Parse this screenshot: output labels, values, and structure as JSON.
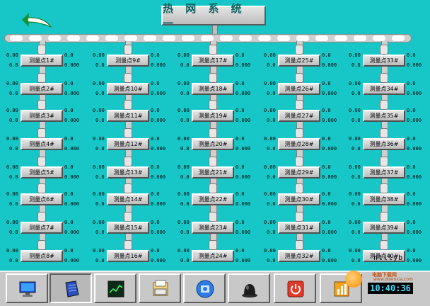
{
  "window": {
    "title": "热 网 系 统 一"
  },
  "colors": {
    "background": "#17c7c7",
    "pipe": "#cfcfcf",
    "clock_text": "#3fe0ff"
  },
  "points": [
    {
      "label": "测量点1#",
      "left": [
        "0.00",
        "0.0"
      ],
      "right": [
        "0.0",
        "0.000"
      ]
    },
    {
      "label": "测量点2#",
      "left": [
        "0.00",
        "0.0"
      ],
      "right": [
        "0.0",
        "0.000"
      ]
    },
    {
      "label": "测量点3#",
      "left": [
        "0.00",
        "0.0"
      ],
      "right": [
        "0.0",
        "0.000"
      ]
    },
    {
      "label": "测量点4#",
      "left": [
        "0.00",
        "0.0"
      ],
      "right": [
        "0.0",
        "0.000"
      ]
    },
    {
      "label": "测量点5#",
      "left": [
        "0.00",
        "0.0"
      ],
      "right": [
        "0.0",
        "0.000"
      ]
    },
    {
      "label": "测量点6#",
      "left": [
        "0.00",
        "0.0"
      ],
      "right": [
        "0.0",
        "0.000"
      ]
    },
    {
      "label": "测量点7#",
      "left": [
        "0.00",
        "0.0"
      ],
      "right": [
        "0.0",
        "0.000"
      ]
    },
    {
      "label": "测量点8#",
      "left": [
        "0.00",
        "0.0"
      ],
      "right": [
        "0.0",
        "0.000"
      ]
    },
    {
      "label": "测量点9#",
      "left": [
        "0.00",
        "0.0"
      ],
      "right": [
        "0.0",
        "0.000"
      ]
    },
    {
      "label": "测量点10#",
      "left": [
        "0.00",
        "0.0"
      ],
      "right": [
        "0.0",
        "0.000"
      ]
    },
    {
      "label": "测量点11#",
      "left": [
        "0.00",
        "0.0"
      ],
      "right": [
        "0.0",
        "0.000"
      ]
    },
    {
      "label": "测量点12#",
      "left": [
        "0.00",
        "0.0"
      ],
      "right": [
        "0.0",
        "0.000"
      ]
    },
    {
      "label": "测量点13#",
      "left": [
        "0.00",
        "0.0"
      ],
      "right": [
        "0.0",
        "0.000"
      ]
    },
    {
      "label": "测量点14#",
      "left": [
        "0.00",
        "0.0"
      ],
      "right": [
        "0.0",
        "0.000"
      ]
    },
    {
      "label": "测量点15#",
      "left": [
        "0.00",
        "0.0"
      ],
      "right": [
        "0.0",
        "0.000"
      ]
    },
    {
      "label": "测量点16#",
      "left": [
        "0.00",
        "0.0"
      ],
      "right": [
        "0.0",
        "0.000"
      ]
    },
    {
      "label": "测量点17#",
      "left": [
        "0.00",
        "0.0"
      ],
      "right": [
        "0.0",
        "0.000"
      ]
    },
    {
      "label": "测量点18#",
      "left": [
        "0.00",
        "0.0"
      ],
      "right": [
        "0.0",
        "0.000"
      ]
    },
    {
      "label": "测量点19#",
      "left": [
        "0.00",
        "0.0"
      ],
      "right": [
        "0.0",
        "0.000"
      ]
    },
    {
      "label": "测量点20#",
      "left": [
        "0.00",
        "0.0"
      ],
      "right": [
        "0.0",
        "0.000"
      ]
    },
    {
      "label": "测量点21#",
      "left": [
        "0.00",
        "0.0"
      ],
      "right": [
        "0.0",
        "0.000"
      ]
    },
    {
      "label": "测量点22#",
      "left": [
        "0.00",
        "0.0"
      ],
      "right": [
        "0.0",
        "0.000"
      ]
    },
    {
      "label": "测量点23#",
      "left": [
        "0.00",
        "0.0"
      ],
      "right": [
        "0.0",
        "0.000"
      ]
    },
    {
      "label": "测量点24#",
      "left": [
        "0.00",
        "0.0"
      ],
      "right": [
        "0.0",
        "0.000"
      ]
    },
    {
      "label": "测量点25#",
      "left": [
        "0.00",
        "0.0"
      ],
      "right": [
        "0.0",
        "0.000"
      ]
    },
    {
      "label": "测量点26#",
      "left": [
        "0.00",
        "0.0"
      ],
      "right": [
        "0.0",
        "0.000"
      ]
    },
    {
      "label": "测量点27#",
      "left": [
        "0.00",
        "0.0"
      ],
      "right": [
        "0.0",
        "0.000"
      ]
    },
    {
      "label": "测量点28#",
      "left": [
        "0.00",
        "0.0"
      ],
      "right": [
        "0.0",
        "0.000"
      ]
    },
    {
      "label": "测量点29#",
      "left": [
        "0.00",
        "0.0"
      ],
      "right": [
        "0.0",
        "0.000"
      ]
    },
    {
      "label": "测量点30#",
      "left": [
        "0.00",
        "0.0"
      ],
      "right": [
        "0.0",
        "0.000"
      ]
    },
    {
      "label": "测量点31#",
      "left": [
        "0.00",
        "0.0"
      ],
      "right": [
        "0.0",
        "0.000"
      ]
    },
    {
      "label": "测量点32#",
      "left": [
        "0.00",
        "0.0"
      ],
      "right": [
        "0.0",
        "0.000"
      ]
    },
    {
      "label": "测量点33#",
      "left": [
        "0.00",
        "0.0"
      ],
      "right": [
        "0.0",
        "0.000"
      ]
    },
    {
      "label": "测量点34#",
      "left": [
        "0.00",
        "0.0"
      ],
      "right": [
        "0.0",
        "0.000"
      ]
    },
    {
      "label": "测量点35#",
      "left": [
        "0.00",
        "0.0"
      ],
      "right": [
        "0.0",
        "0.000"
      ]
    },
    {
      "label": "测量点36#",
      "left": [
        "0.00",
        "0.0"
      ],
      "right": [
        "0.0",
        "0.000"
      ]
    },
    {
      "label": "测量点37#",
      "left": [
        "0.00",
        "0.0"
      ],
      "right": [
        "0.0",
        "0.000"
      ]
    },
    {
      "label": "测量点38#",
      "left": [
        "0.00",
        "0.0"
      ],
      "right": [
        "0.0",
        "0.000"
      ]
    },
    {
      "label": "测量点39#",
      "left": [
        "0.00",
        "0.0"
      ],
      "right": [
        "0.0",
        "0.000"
      ]
    },
    {
      "label": "测量点40#",
      "left": [
        "0.00",
        "0.0"
      ],
      "right": [
        "0.0",
        "0.000"
      ]
    }
  ],
  "taskbar": {
    "buttons": [
      {
        "icon": "monitor-icon",
        "pressed": false
      },
      {
        "icon": "document-icon",
        "pressed": true
      },
      {
        "icon": "trend-chart-icon",
        "pressed": false
      },
      {
        "icon": "printer-icon",
        "pressed": false
      },
      {
        "icon": "settings-icon",
        "pressed": false
      },
      {
        "icon": "alarm-light-icon",
        "pressed": false
      },
      {
        "icon": "power-icon",
        "pressed": false
      },
      {
        "icon": "report-icon",
        "pressed": false
      }
    ]
  },
  "user": "ntllyb",
  "clock": "10:40:36",
  "watermark": {
    "text": "电脑下载网",
    "url": "www.downxia.com"
  }
}
